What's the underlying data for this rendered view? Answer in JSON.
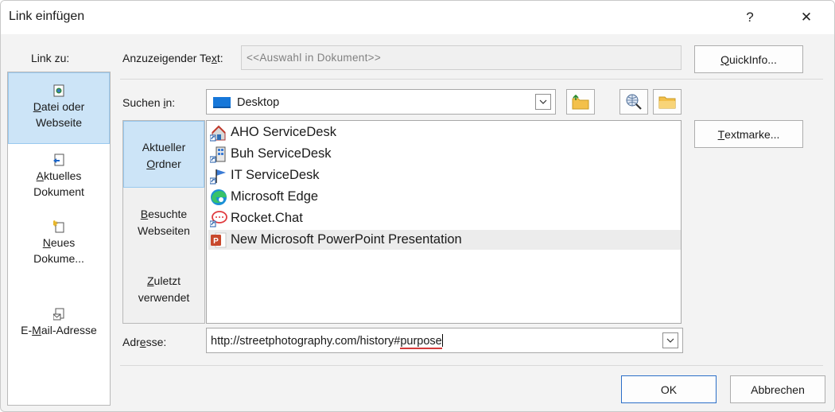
{
  "window": {
    "title": "Link einfügen",
    "help_glyph": "?",
    "close_glyph": "✕"
  },
  "link_to": {
    "label": "Link zu:",
    "items": [
      {
        "line1_pre": "",
        "line1_u": "D",
        "line1_post": "atei oder",
        "line2": "Webseite",
        "icon": "file-web-icon"
      },
      {
        "line1_pre": "",
        "line1_u": "A",
        "line1_post": "ktuelles",
        "line2": "Dokument",
        "icon": "current-document-icon"
      },
      {
        "line1_pre": "",
        "line1_u": "N",
        "line1_post": "eues",
        "line2": "Dokume...",
        "icon": "new-document-icon"
      },
      {
        "line1_pre": "E-",
        "line1_u": "M",
        "line1_post": "ail-Adresse",
        "line2": "",
        "icon": "email-icon"
      }
    ]
  },
  "display_text": {
    "label_pre": "Anzuzeigender Te",
    "label_u": "x",
    "label_post": "t:",
    "value": "<<Auswahl in Dokument>>"
  },
  "quickinfo": {
    "pre": "",
    "u": "Q",
    "post": "uickInfo..."
  },
  "search_in": {
    "label_pre": "Suchen ",
    "label_u": "i",
    "label_post": "n:",
    "value": "Desktop"
  },
  "nav": [
    {
      "line1": "Aktueller",
      "line2_u": "O",
      "line2_post": "rdner",
      "line1_u": "",
      "line1_post": ""
    },
    {
      "line1_u": "B",
      "line1_post": "esuchte",
      "line2": "Webseiten"
    },
    {
      "line1_u": "Z",
      "line1_post": "uletzt",
      "line2": "verwendet"
    }
  ],
  "files": [
    {
      "name": "AHO ServiceDesk",
      "icon": "house-shortcut-icon"
    },
    {
      "name": "Buh ServiceDesk",
      "icon": "building-shortcut-icon"
    },
    {
      "name": "IT ServiceDesk",
      "icon": "flag-shortcut-icon"
    },
    {
      "name": "Microsoft Edge",
      "icon": "edge-icon"
    },
    {
      "name": "Rocket.Chat",
      "icon": "rocketchat-icon"
    },
    {
      "name": "New Microsoft PowerPoint Presentation",
      "icon": "powerpoint-icon"
    }
  ],
  "bookmark": {
    "pre": "",
    "u": "T",
    "post": "extmarke..."
  },
  "address": {
    "label_pre": "Adr",
    "label_u": "e",
    "label_post": "sse:",
    "value_pre": "http://streetphotography.com/history#",
    "value_err": "purpose"
  },
  "ok": "OK",
  "cancel": "Abbrechen",
  "colors": {
    "selection": "#cce4f7",
    "selection_border": "#99c9ef",
    "folder": "#f3c04a",
    "desktop_blue": "#1677d9",
    "spell_error": "#d43a3a"
  }
}
